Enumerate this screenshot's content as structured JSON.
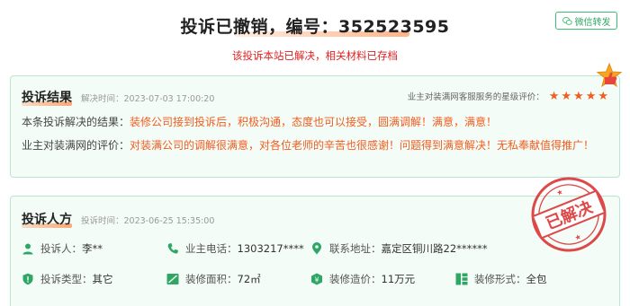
{
  "header": {
    "title": "投诉已撤销，编号：352523595",
    "subtitle": "该投诉本站已解决，相关材料已存档",
    "wechat_button": "微信转发"
  },
  "result": {
    "title": "投诉结果",
    "time": "解决时间：2023-07-03 17:00:20",
    "rating_label": "业主对装满网客服服务的星级评价：",
    "stars": 5,
    "rows": [
      {
        "label": "本条投诉解决的结果：",
        "value": "装修公司接到投诉后，积极沟通，态度也可以接受，圆满调解！满意，满意！"
      },
      {
        "label": "业主对装满网的评价：",
        "value": "对装满公司的调解很满意，对各位老师的辛苦也很感谢！问题得到满意解决！无私奉献值得推广！"
      }
    ]
  },
  "complainant": {
    "title": "投诉人方",
    "time": "投诉时间：2023-06-25 15:35:00",
    "stamp_text": "已解决",
    "items": [
      {
        "icon": "user-icon",
        "label": "投诉人：",
        "value": "李**"
      },
      {
        "icon": "phone-icon",
        "label": "业主电话：",
        "value": "1303217****"
      },
      {
        "icon": "location-icon",
        "label": "联系地址：",
        "value": "嘉定区铜川路22******"
      },
      {
        "icon": "shield-icon",
        "label": "投诉类型：",
        "value": "其它"
      },
      {
        "icon": "ruler-icon",
        "label": "装修面积：",
        "value": "72㎡"
      },
      {
        "icon": "yuan-icon",
        "label": "装修造价：",
        "value": "11万元"
      },
      {
        "icon": "grid-icon",
        "label": "装修形式：",
        "value": "全包"
      }
    ]
  },
  "colors": {
    "accent": "#f25c1d",
    "green": "#3cbf72",
    "red": "#e02020",
    "card_bg": "#f4fcf8",
    "card_border": "#b9e6cf"
  }
}
